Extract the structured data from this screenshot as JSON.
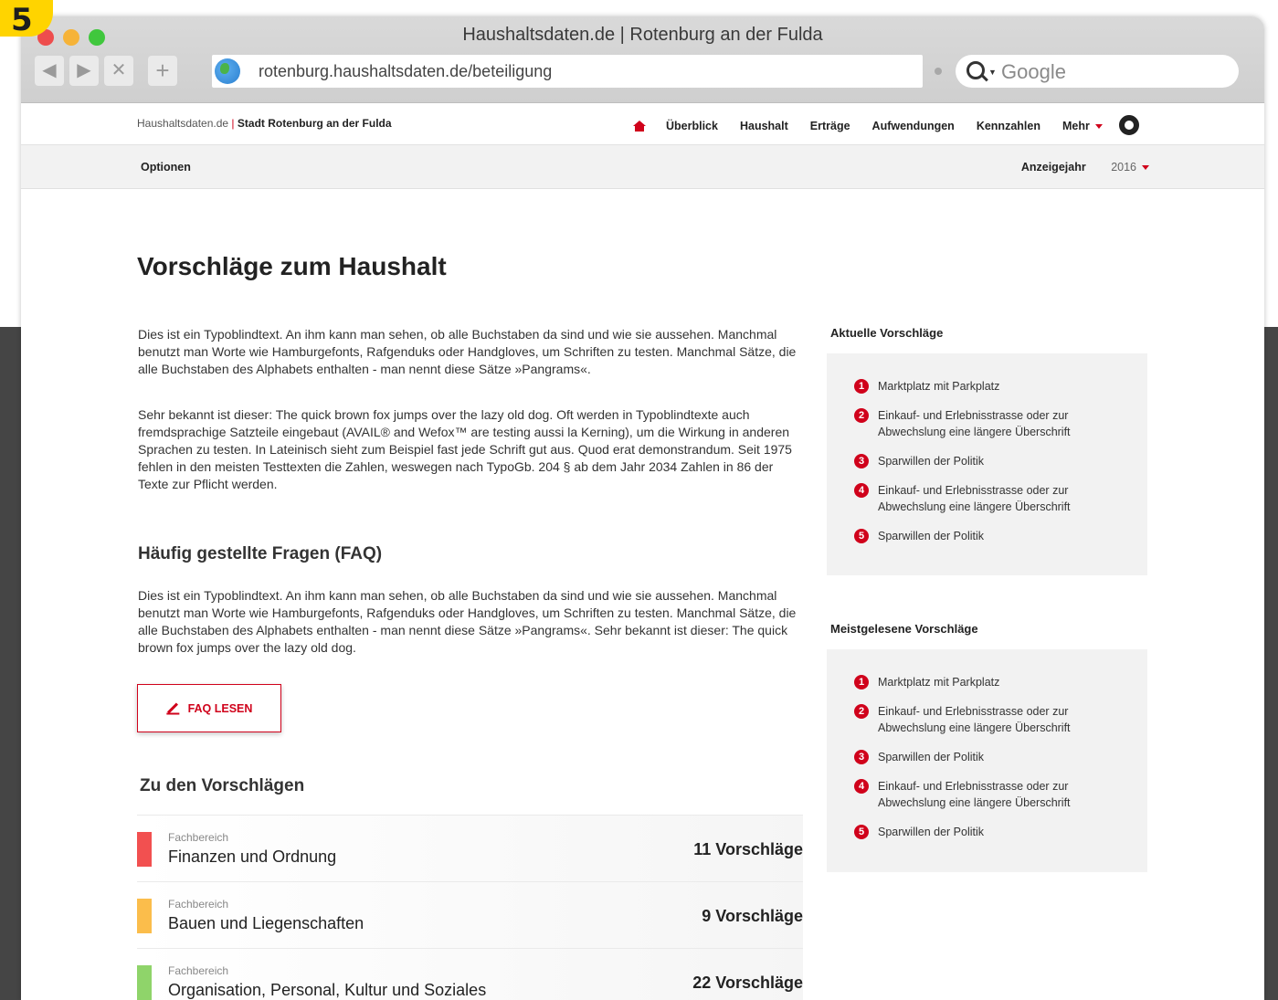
{
  "badge": "5",
  "window_title": "Haushaltsdaten.de | Rotenburg an der Fulda",
  "nav_buttons": {
    "back": "◀",
    "forward": "▶",
    "stop": "✕",
    "new_tab": "+"
  },
  "url": "rotenburg.haushaltsdaten.de/beteiligung",
  "search_placeholder": "Google",
  "brand": {
    "site": "Haushaltsdaten.de",
    "separator": "|",
    "city": "Stadt Rotenburg an der Fulda"
  },
  "menu": [
    "Überblick",
    "Haushalt",
    "Erträge",
    "Aufwendungen",
    "Kennzahlen",
    "Mehr"
  ],
  "subnav": {
    "options": "Optionen",
    "year_label": "Anzeigejahr",
    "year_value": "2016"
  },
  "page_title": "Vorschläge zum Haushalt",
  "intro": [
    "Dies ist ein Typoblindtext. An ihm kann man sehen, ob alle Buchstaben da sind und wie sie aussehen. Manchmal benutzt man Worte wie Hamburgefonts, Rafgenduks oder Handgloves, um Schriften zu testen. Manchmal Sätze, die alle Buchstaben des Alphabets enthalten - man nennt diese Sätze »Pangrams«.",
    "Sehr bekannt ist dieser: The quick brown fox jumps over the lazy old dog. Oft werden in Typoblindtexte auch fremdsprachige Satzteile eingebaut (AVAIL® and Wefox™ are testing aussi la Kerning), um die Wirkung in anderen Sprachen zu testen. In Lateinisch sieht zum Beispiel fast jede Schrift gut aus. Quod erat demonstrandum. Seit 1975 fehlen in den meisten Testtexten die Zahlen, weswegen nach TypoGb. 204 § ab dem Jahr 2034 Zahlen in 86 der Texte zur Pflicht werden."
  ],
  "faq": {
    "heading": "Häufig gestellte Fragen (FAQ)",
    "text": "Dies ist ein Typoblindtext. An ihm kann man sehen, ob alle Buchstaben da sind und wie sie aussehen. Manchmal benutzt man Worte wie Hamburgefonts, Rafgenduks oder Handgloves, um Schriften zu testen. Manchmal Sätze, die alle Buchstaben des Alphabets enthalten - man nennt diese Sätze »Pangrams«. Sehr bekannt ist dieser: The quick brown fox jumps over the lazy old dog.",
    "button": "FAQ LESEN"
  },
  "proposals": {
    "heading": "Zu den Vorschlägen",
    "categories": [
      {
        "label": "Fachbereich",
        "title": "Finanzen und Ordnung",
        "count": "11 Vorschläge",
        "color": "#f25050"
      },
      {
        "label": "Fachbereich",
        "title": "Bauen und Liegenschaften",
        "count": "9 Vorschläge",
        "color": "#fbbd4b"
      },
      {
        "label": "Fachbereich",
        "title": "Organisation, Personal, Kultur und Soziales",
        "count": "22 Vorschläge",
        "color": "#8fd46a"
      }
    ]
  },
  "sidebar": {
    "current": {
      "title": "Aktuelle Vorschläge",
      "items": [
        {
          "n": "1",
          "text": "Marktplatz mit Parkplatz"
        },
        {
          "n": "2",
          "text": "Einkauf- und Erlebnisstrasse oder zur Abwechslung eine längere Überschrift"
        },
        {
          "n": "3",
          "text": "Sparwillen der Politik"
        },
        {
          "n": "4",
          "text": "Einkauf- und Erlebnisstrasse oder zur Abwechslung eine längere Überschrift"
        },
        {
          "n": "5",
          "text": "Sparwillen der Politik"
        }
      ]
    },
    "most_read": {
      "title": "Meistgelesene Vorschläge",
      "items": [
        {
          "n": "1",
          "text": "Marktplatz mit Parkplatz"
        },
        {
          "n": "2",
          "text": "Einkauf- und Erlebnisstrasse oder zur Abwechslung eine längere Überschrift"
        },
        {
          "n": "3",
          "text": "Sparwillen der Politik"
        },
        {
          "n": "4",
          "text": "Einkauf- und Erlebnisstrasse oder zur Abwechslung eine längere Überschrift"
        },
        {
          "n": "5",
          "text": "Sparwillen der Politik"
        }
      ]
    }
  },
  "colors": {
    "accent": "#d0021b"
  }
}
